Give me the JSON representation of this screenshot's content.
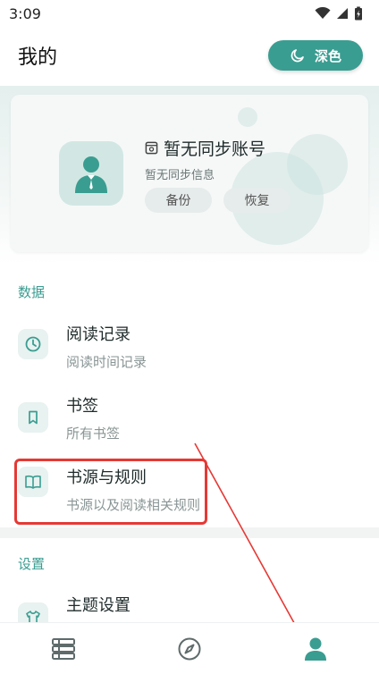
{
  "status_bar": {
    "time": "3:09"
  },
  "header": {
    "title": "我的",
    "theme_button_label": "深色"
  },
  "account_card": {
    "name": "暂无同步账号",
    "subtitle": "暂无同步信息",
    "backup_label": "备份",
    "restore_label": "恢复"
  },
  "sections": {
    "data": {
      "title": "数据",
      "items": [
        {
          "title": "阅读记录",
          "subtitle": "阅读时间记录"
        },
        {
          "title": "书签",
          "subtitle": "所有书签"
        },
        {
          "title": "书源与规则",
          "subtitle": "书源以及阅读相关规则"
        }
      ]
    },
    "settings": {
      "title": "设置",
      "items": [
        {
          "title": "主题设置"
        }
      ]
    }
  },
  "icons": {
    "theme_button": "moon-icon",
    "reading_record": "clock-icon",
    "bookmark": "bookmark-icon",
    "book_source": "open-book-icon",
    "theme_settings": "shirt-icon",
    "nav_bookshelf": "bookshelf-icon",
    "nav_discover": "compass-icon",
    "nav_mine": "person-icon"
  },
  "colors": {
    "accent": "#3a9d91",
    "annotation": "#e53935",
    "nav_inactive": "#5f6b6b"
  }
}
